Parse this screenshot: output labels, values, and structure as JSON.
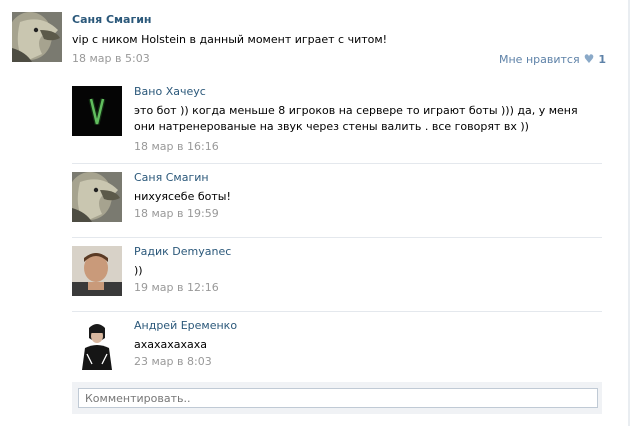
{
  "post": {
    "author": "Саня Смагин",
    "text": "vip с ником Holstein в данный момент играет с читом!",
    "date": "18 мар в 5:03",
    "like_label": "Мне нравится",
    "like_count": "1"
  },
  "comments": [
    {
      "author": "Вано Хачеус",
      "text": "это бот )) когда меньше 8 игроков на сервере то играют боты ))) да, у меня они натренерованые на звук через стены валить . все говорят вх ))",
      "date": "18 мар в 16:16"
    },
    {
      "author": "Саня Смагин",
      "text": "нихуясебе боты!",
      "date": "18 мар в 19:59"
    },
    {
      "author": "Радик Demyanec",
      "text": "))",
      "date": "19 мар в 12:16"
    },
    {
      "author": "Андрей Еременко",
      "text": "ахахахахаха",
      "date": "23 мар в 8:03"
    }
  ],
  "comment_input": {
    "placeholder": "Комментировать.."
  },
  "colors": {
    "link": "#2b587a",
    "date": "#999999",
    "separator": "#e4e8ed",
    "like": "#5e82a8"
  }
}
